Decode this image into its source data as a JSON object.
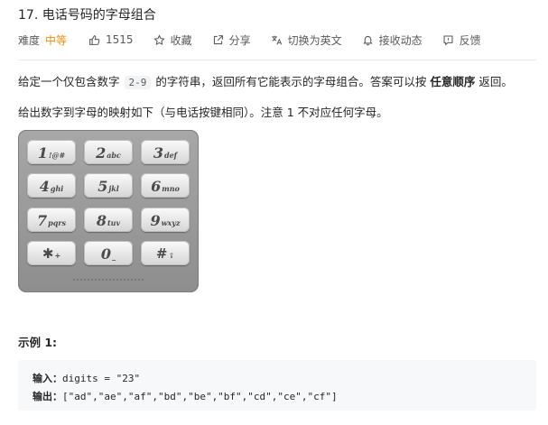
{
  "problem": {
    "title": "17. 电话号码的字母组合"
  },
  "meta": {
    "difficulty_label": "难度",
    "difficulty_value": "中等",
    "likes": "1515",
    "favorite_label": "收藏",
    "share_label": "分享",
    "translate_label": "切换为英文",
    "subscribe_label": "接收动态",
    "feedback_label": "反馈",
    "difficulty_color": "#ef8f14"
  },
  "description": {
    "line1_part1": "给定一个仅包含数字",
    "line1_code": "2-9",
    "line1_part2": "的字符串，返回所有它能表示的字母组合。答案可以按",
    "line1_bold": "任意顺序",
    "line1_part3": "返回。",
    "line2": "给出数字到字母的映射如下（与电话按键相同）。注意 1 不对应任何字母。"
  },
  "keypad": {
    "keys": [
      {
        "digit": "1",
        "letters": "!@#"
      },
      {
        "digit": "2",
        "letters": "abc"
      },
      {
        "digit": "3",
        "letters": "def"
      },
      {
        "digit": "4",
        "letters": "ghi"
      },
      {
        "digit": "5",
        "letters": "jkl"
      },
      {
        "digit": "6",
        "letters": "mno"
      },
      {
        "digit": "7",
        "letters": "pqrs"
      },
      {
        "digit": "8",
        "letters": "tuv"
      },
      {
        "digit": "9",
        "letters": "wxyz"
      },
      {
        "digit": "✱",
        "letters": "+"
      },
      {
        "digit": "0",
        "letters": "_"
      },
      {
        "digit": "#",
        "letters": "⇪"
      }
    ]
  },
  "example": {
    "title": "示例 1:",
    "input_label": "输入：",
    "input_value": "digits = \"23\"",
    "output_label": "输出：",
    "output_value": "[\"ad\",\"ae\",\"af\",\"bd\",\"be\",\"bf\",\"cd\",\"ce\",\"cf\"]"
  }
}
